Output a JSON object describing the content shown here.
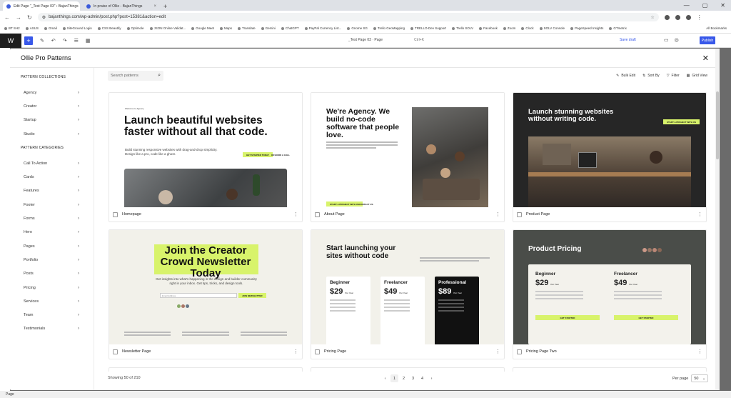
{
  "browser": {
    "tabs": [
      {
        "label": "Edit Page “_Test Page 03” ‹ BajanThings"
      },
      {
        "label": "In praise of Ollie - BajanThings"
      }
    ],
    "url": "bajanthings.com/wp-admin/post.php?post=15381&action=edit",
    "bookmarks": [
      "BT SH2",
      "ASUS",
      "Gmail",
      "SiteGround Login",
      "CSS Beautify",
      "Optimole",
      "JSON Online Validat...",
      "Google Meet",
      "Maps",
      "Translate",
      "Gemini",
      "ChatGPT",
      "PayPal Currency List...",
      "Gnome SG",
      "Trello GeoMapping",
      "TRELLO-Dev Support",
      "Trello SOLV",
      "Facebook",
      "Zoom",
      "Clock",
      "SOLV Console",
      "PageSpeed Insights",
      "GTmetrix"
    ],
    "all_bookmarks": "All Bookmarks"
  },
  "wp": {
    "doc_title": "_Test Page 03 · Page",
    "shortcut": "Ctrl+K",
    "save_draft": "Save draft",
    "publish": "Publish",
    "status": "Page"
  },
  "modal": {
    "title": "Ollie Pro Patterns",
    "close": "✕",
    "collections_heading": "PATTERN COLLECTIONS",
    "collections": [
      "Agency",
      "Creator",
      "Startup",
      "Studio"
    ],
    "categories_heading": "PATTERN CATEGORIES",
    "categories": [
      "Call To Action",
      "Cards",
      "Features",
      "Footer",
      "Forms",
      "Hero",
      "Pages",
      "Portfolio",
      "Posts",
      "Pricing",
      "Services",
      "Team",
      "Testimonials"
    ],
    "search_placeholder": "Search patterns",
    "bulk_edit": "Bulk Edit",
    "sort_by": "Sort By",
    "filter": "Filter",
    "grid_view": "Grid View",
    "showing": "Showing 50 of 210",
    "pages": [
      "1",
      "2",
      "3",
      "4"
    ],
    "per_page_label": "Per page",
    "per_page_value": "50"
  },
  "cards": [
    {
      "label": "Homepage",
      "headline": "Launch beautiful websites faster without all that code.",
      "eyebrow": "Welcome to Agency",
      "sub": "Build stunning responsive websites with drag-and-drop simplicity. Design like a pro, code like a ghost.",
      "btn1": "GET STARTED TODAY",
      "btn2": "OR BOOK A CALL"
    },
    {
      "label": "About Page",
      "headline": "We're Agency. We build no-code software that people love.",
      "btn1": "START A PROJECT WITH US",
      "btn2": "CONTACT US"
    },
    {
      "label": "Product Page",
      "headline": "Launch stunning websites without writing code.",
      "btn1": "START A PROJECT WITH US"
    },
    {
      "label": "Newsletter Page",
      "headline": "Join the Creator Crowd Newsletter Today",
      "sub": "Get insights into what's happening in the design and builder community right in your inbox. Get tips, tricks, and design tools.",
      "placeholder": "Email Address",
      "btn1": "JOIN NEWSLETTER"
    },
    {
      "label": "Pricing Page",
      "headline": "Start launching your sites without code",
      "plans": [
        {
          "name": "Beginner",
          "price": "$29"
        },
        {
          "name": "Freelancer",
          "price": "$49"
        },
        {
          "name": "Professional",
          "price": "$89"
        }
      ],
      "per": "Per Year"
    },
    {
      "label": "Pricing Page Two",
      "headline": "Product Pricing",
      "plans": [
        {
          "name": "Beginner",
          "price": "$29"
        },
        {
          "name": "Freelancer",
          "price": "$49"
        }
      ],
      "per": "Per Year",
      "btn1": "GET STARTED",
      "btn2": "GET STARTED"
    }
  ],
  "colors": {
    "accent": "#d8f36b",
    "wp_blue": "#3858e9",
    "dark": "#2c2c2c"
  }
}
